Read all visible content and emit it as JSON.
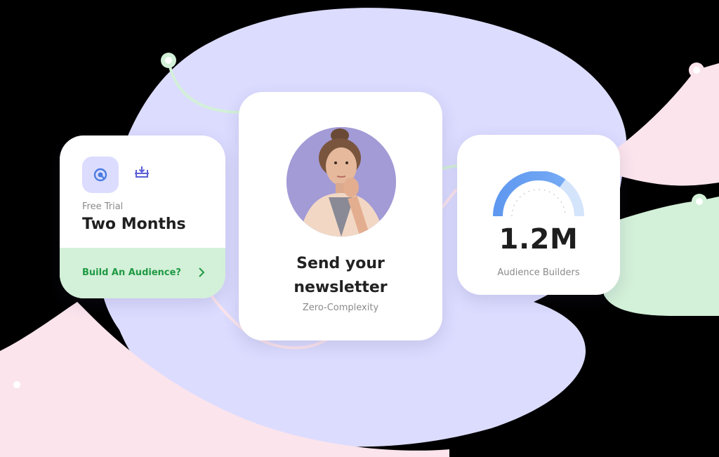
{
  "trial_card": {
    "label": "Free Trial",
    "value": "Two Months",
    "cta": "Build An Audience?",
    "icons": [
      "clock-arrow-icon",
      "download-tray-icon",
      "chevron-right-icon"
    ]
  },
  "newsletter_card": {
    "title_line1": "Send your",
    "title_line2": "newsletter",
    "subtitle": "Zero-Complexity",
    "avatar": "woman-thinking-photo"
  },
  "stats_card": {
    "value": "1.2M",
    "label": "Audience Builders",
    "gauge_fill": 0.7
  },
  "colors": {
    "blob": "#dcdcff",
    "accent_blue": "#5f98f0",
    "accent_green": "#1f9a44",
    "green_bar": "#d3f0d8",
    "pink_line": "#fbe4ec",
    "green_line": "#d3f0d8"
  }
}
